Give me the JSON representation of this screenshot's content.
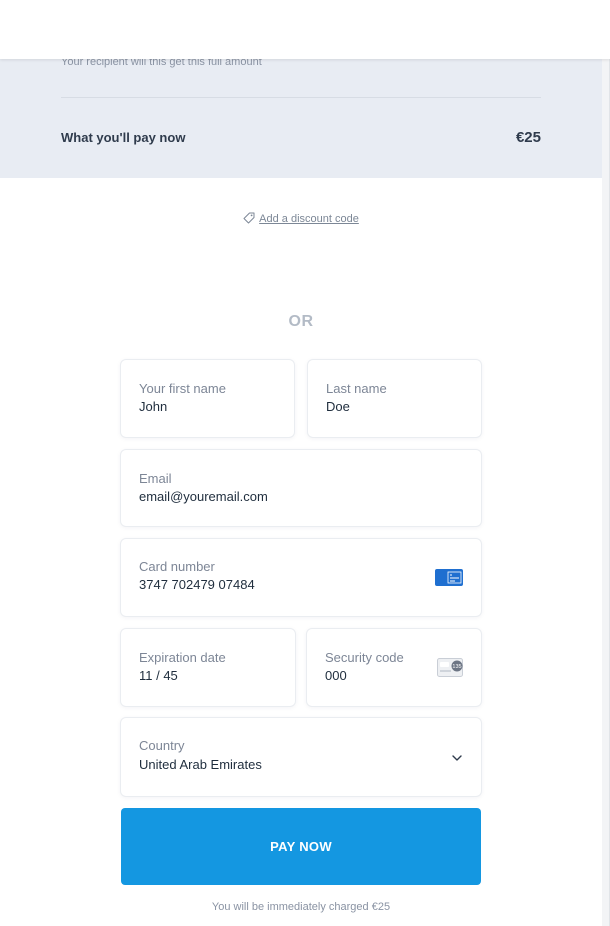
{
  "summary": {
    "recipient_note": "Your recipient will this get this full amount",
    "pay_now_label": "What you'll pay now",
    "pay_now_amount": "€25"
  },
  "discount": {
    "link_label": "Add a discount code",
    "icon": "tag-icon"
  },
  "divider_text": "OR",
  "form": {
    "first_name": {
      "label": "Your first name",
      "value": "John"
    },
    "last_name": {
      "label": "Last name",
      "value": "Doe"
    },
    "email": {
      "label": "Email",
      "value": "email@youremail.com"
    },
    "card_number": {
      "label": "Card number",
      "value": "3747 702479 07484",
      "brand_icon": "amex-card-icon"
    },
    "expiration": {
      "label": "Expiration date",
      "value": "11 / 45"
    },
    "security_code": {
      "label": "Security code",
      "value": "000",
      "icon": "cvc-card-icon",
      "icon_text": "135"
    },
    "country": {
      "label": "Country",
      "value": "United Arab Emirates",
      "icon": "chevron-down-icon"
    }
  },
  "pay_button": {
    "label": "PAY NOW"
  },
  "charge_note": "You will be immediately charged €25",
  "colors": {
    "accent": "#1497e1",
    "summary_bg": "#e8ecf3",
    "amex": "#1f6fd0",
    "text_dark": "#2f3b4c",
    "text_muted": "#7d8696"
  }
}
